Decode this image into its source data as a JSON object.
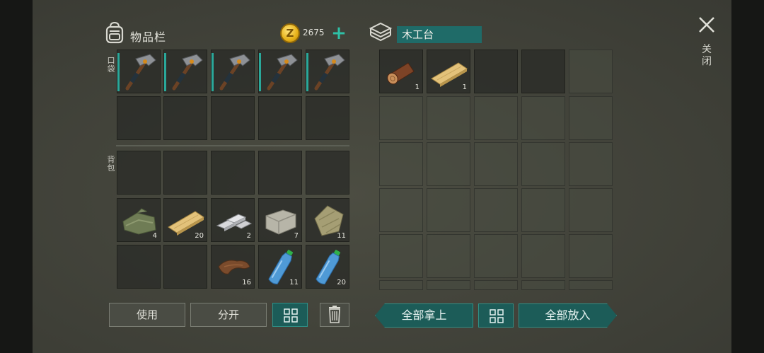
{
  "header": {
    "inventory_title": "物品栏",
    "coins": "2675",
    "coin_symbol": "Z",
    "plus": "+",
    "station_title": "木工台",
    "close_label": "关闭"
  },
  "sections": {
    "pocket_label": "口袋",
    "backpack_label": "背包"
  },
  "pocket_slots": [
    {
      "item": "pickaxe",
      "qty": ""
    },
    {
      "item": "pickaxe",
      "qty": ""
    },
    {
      "item": "pickaxe",
      "qty": ""
    },
    {
      "item": "pickaxe",
      "qty": ""
    },
    {
      "item": "pickaxe",
      "qty": ""
    }
  ],
  "backpack_slots": [
    {
      "item": "cloth",
      "qty": "4"
    },
    {
      "item": "plank",
      "qty": "20"
    },
    {
      "item": "metal-bars",
      "qty": "2"
    },
    {
      "item": "stone",
      "qty": "7"
    },
    {
      "item": "fiber",
      "qty": "11"
    },
    {
      "item": "leather",
      "qty": "16"
    },
    {
      "item": "water-bottle",
      "qty": "11"
    },
    {
      "item": "water-bottle",
      "qty": "20"
    }
  ],
  "station_slots": [
    {
      "item": "log",
      "qty": "1"
    },
    {
      "item": "plank",
      "qty": "1"
    }
  ],
  "buttons": {
    "use": "使用",
    "split": "分开",
    "take_all": "全部拿上",
    "put_all": "全部放入"
  },
  "colors": {
    "accent": "#2aa89a",
    "teal_button": "#1c5c58",
    "coin": "#e6b118"
  }
}
